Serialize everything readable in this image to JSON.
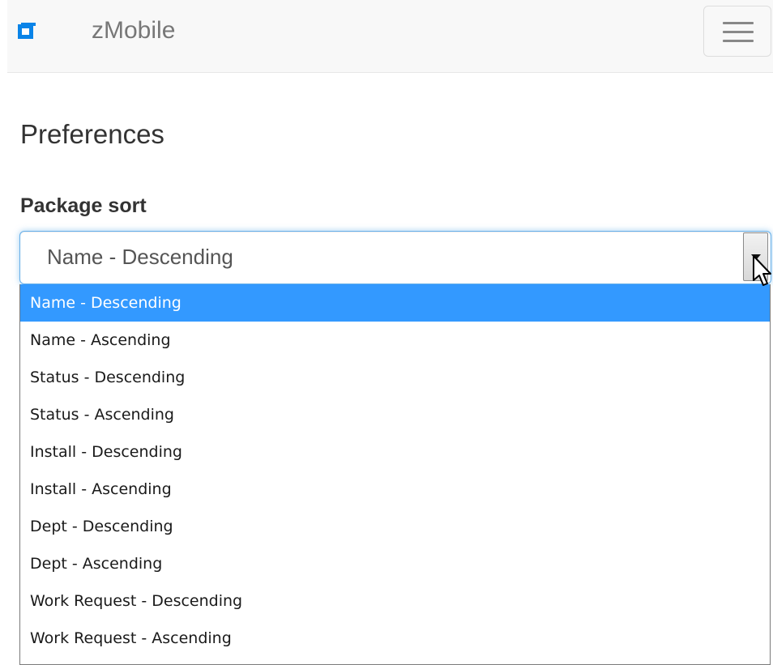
{
  "app": {
    "brand_name": "zMobile",
    "logo_icon": "square-logo-icon",
    "menu_icon": "hamburger-menu-icon"
  },
  "page": {
    "title": "Preferences"
  },
  "package_sort": {
    "label": "Package sort",
    "selected_value": "Name - Descending",
    "options": [
      "Name - Descending",
      "Name - Ascending",
      "Status - Descending",
      "Status - Ascending",
      "Install - Descending",
      "Install - Ascending",
      "Dept - Descending",
      "Dept - Ascending",
      "Work Request - Descending",
      "Work Request - Ascending"
    ],
    "highlighted_index": 0
  },
  "colors": {
    "brand_blue": "#0a84e8",
    "navbar_bg": "#f8f8f8",
    "focus_border": "#66afe9",
    "option_highlight": "#3399ff",
    "text": "#333333"
  }
}
